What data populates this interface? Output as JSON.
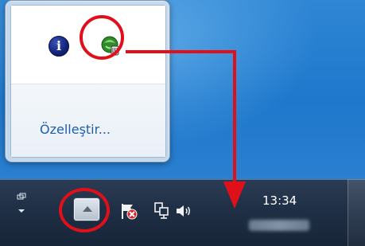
{
  "popup": {
    "customize_label": "Özelleştir...",
    "icons": [
      {
        "name": "info-icon",
        "glyph": "i"
      },
      {
        "name": "green-app-icon"
      }
    ]
  },
  "taskbar": {
    "clock": "13:34",
    "tray_icons": [
      "action-center-flag-icon",
      "network-icon",
      "volume-icon"
    ],
    "overflow_button": "show-hidden-icons-up-arrow"
  },
  "annotations": {
    "highlight_color": "#e0101a"
  }
}
